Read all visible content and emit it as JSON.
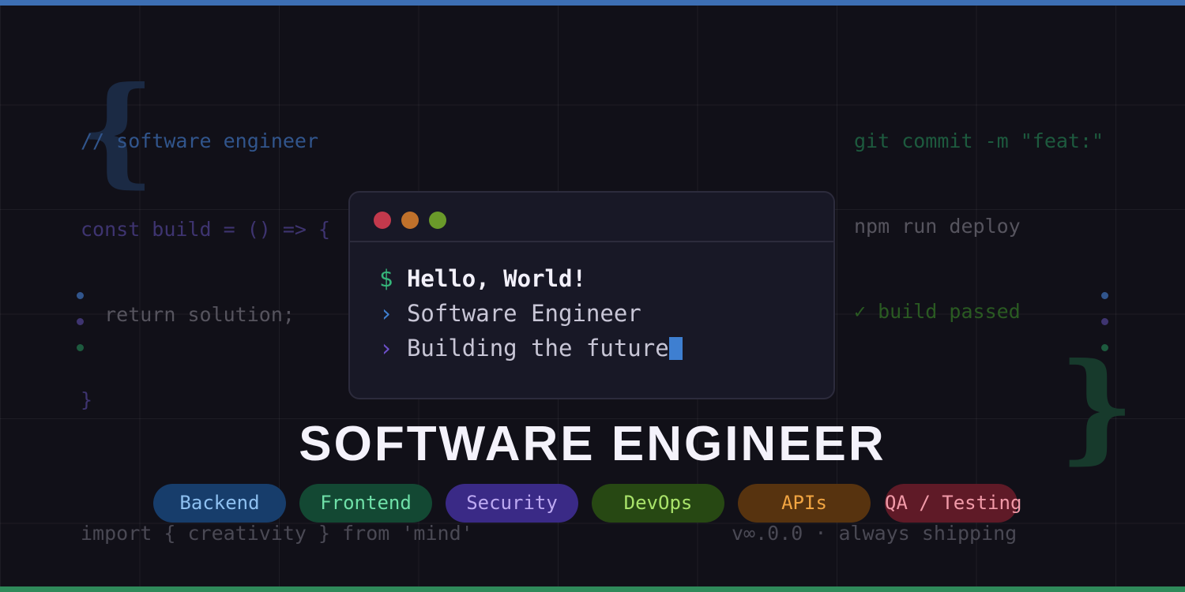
{
  "background_code_left": [
    "// software engineer",
    "const build = () => {",
    "  return solution;",
    "}"
  ],
  "background_code_right": [
    "git commit -m \"feat:\"",
    "npm run deploy",
    "✓ build passed"
  ],
  "decor": {
    "brace_left": "{",
    "brace_right": "}"
  },
  "terminal": {
    "line1_prompt": "$",
    "line1_text": "Hello, World!",
    "line2_prompt": "›",
    "line2_text": "Software Engineer",
    "line3_prompt": "›",
    "line3_text": "Building the future"
  },
  "headline": "SOFTWARE ENGINEER",
  "tags": [
    "Backend",
    "Frontend",
    "Security",
    "DevOps",
    "APIs",
    "QA / Testing"
  ],
  "footer": {
    "left": "import { creativity } from 'mind'",
    "right": "v∞.0.0 · always shipping"
  },
  "colors": {
    "background": "#111018",
    "top_bar": "#3d6fb3",
    "bottom_bar": "#2f8a5a",
    "terminal_bg": "#181826",
    "cursor": "#3e7fd1"
  }
}
